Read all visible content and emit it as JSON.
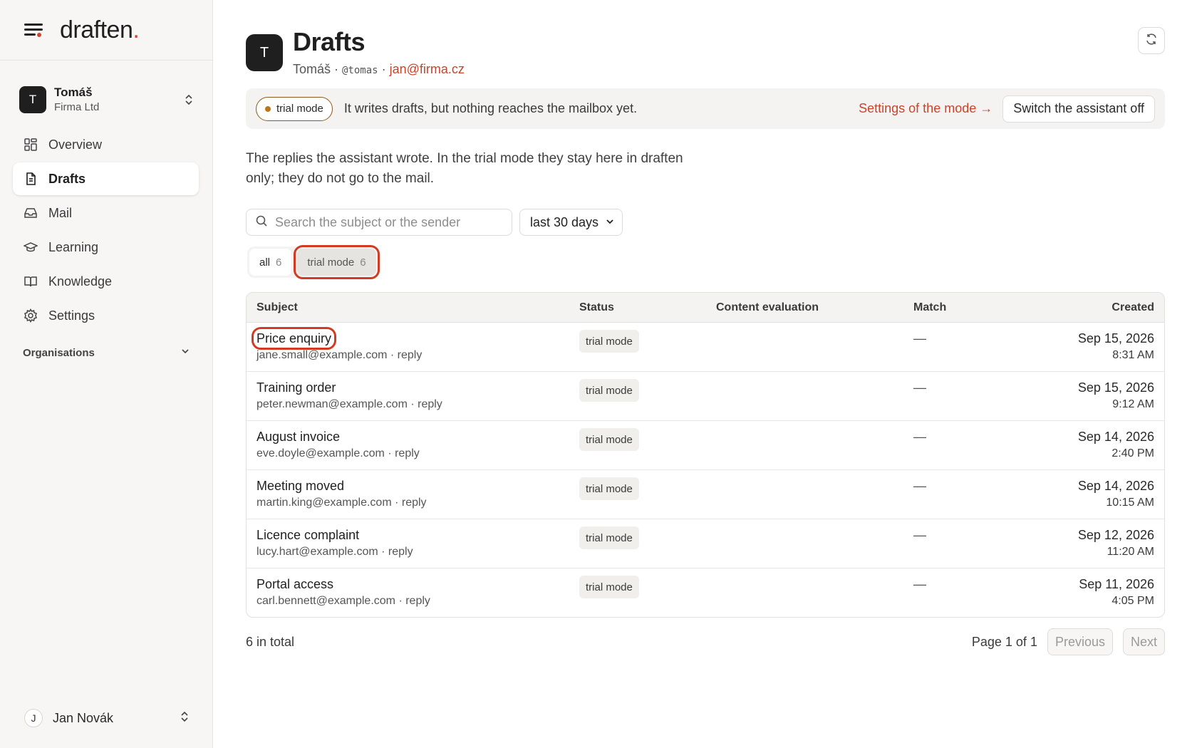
{
  "brand": {
    "name": "draften",
    "dot": "."
  },
  "org": {
    "initial": "T",
    "name": "Tomáš",
    "company": "Firma Ltd"
  },
  "nav": {
    "items": [
      {
        "label": "Overview",
        "icon": "grid-icon"
      },
      {
        "label": "Drafts",
        "icon": "document-icon",
        "active": true
      },
      {
        "label": "Mail",
        "icon": "inbox-icon"
      },
      {
        "label": "Learning",
        "icon": "graduation-cap-icon"
      },
      {
        "label": "Knowledge",
        "icon": "book-icon"
      },
      {
        "label": "Settings",
        "icon": "gear-icon"
      }
    ],
    "organisations_label": "Organisations"
  },
  "user": {
    "initial": "J",
    "name": "Jan Novák"
  },
  "header": {
    "initial": "T",
    "title": "Drafts",
    "name": "Tomáš",
    "separator": " · ",
    "handle": "@tomas",
    "email": "jan@firma.cz"
  },
  "banner": {
    "pill_label": "trial mode",
    "text": "It writes drafts, but nothing reaches the mailbox yet.",
    "settings_link": "Settings of the mode →",
    "off_button": "Switch the assistant off"
  },
  "intro_text": "The replies the assistant wrote. In the trial mode they stay here in draften only; they do not go to the mail.",
  "search": {
    "placeholder": "Search the subject or the sender",
    "value": ""
  },
  "range": {
    "selected": "last 30 days"
  },
  "filters": {
    "all_label": "all",
    "all_count": "6",
    "trial_label": "trial mode",
    "trial_count": "6"
  },
  "table": {
    "columns": {
      "subject": "Subject",
      "status": "Status",
      "evaluation": "Content evaluation",
      "match": "Match",
      "created": "Created"
    },
    "rows": [
      {
        "subject": "Price enquiry",
        "meta": "jane.small@example.com · reply",
        "status": "trial mode",
        "match": "—",
        "date": "Sep 15, 2026",
        "time": "8:31 AM"
      },
      {
        "subject": "Training order",
        "meta": "peter.newman@example.com · reply",
        "status": "trial mode",
        "match": "—",
        "date": "Sep 15, 2026",
        "time": "9:12 AM"
      },
      {
        "subject": "August invoice",
        "meta": "eve.doyle@example.com · reply",
        "status": "trial mode",
        "match": "—",
        "date": "Sep 14, 2026",
        "time": "2:40 PM"
      },
      {
        "subject": "Meeting moved",
        "meta": "martin.king@example.com · reply",
        "status": "trial mode",
        "match": "—",
        "date": "Sep 14, 2026",
        "time": "10:15 AM"
      },
      {
        "subject": "Licence complaint",
        "meta": "lucy.hart@example.com · reply",
        "status": "trial mode",
        "match": "—",
        "date": "Sep 12, 2026",
        "time": "11:20 AM"
      },
      {
        "subject": "Portal access",
        "meta": "carl.bennett@example.com · reply",
        "status": "trial mode",
        "match": "—",
        "date": "Sep 11, 2026",
        "time": "4:05 PM"
      }
    ]
  },
  "footer": {
    "total": "6 in total",
    "page_info": "Page 1 of 1",
    "prev": "Previous",
    "next": "Next"
  },
  "colors": {
    "accent": "#c8442b",
    "highlight": "#d23a22",
    "pill_dot": "#b8761f"
  }
}
